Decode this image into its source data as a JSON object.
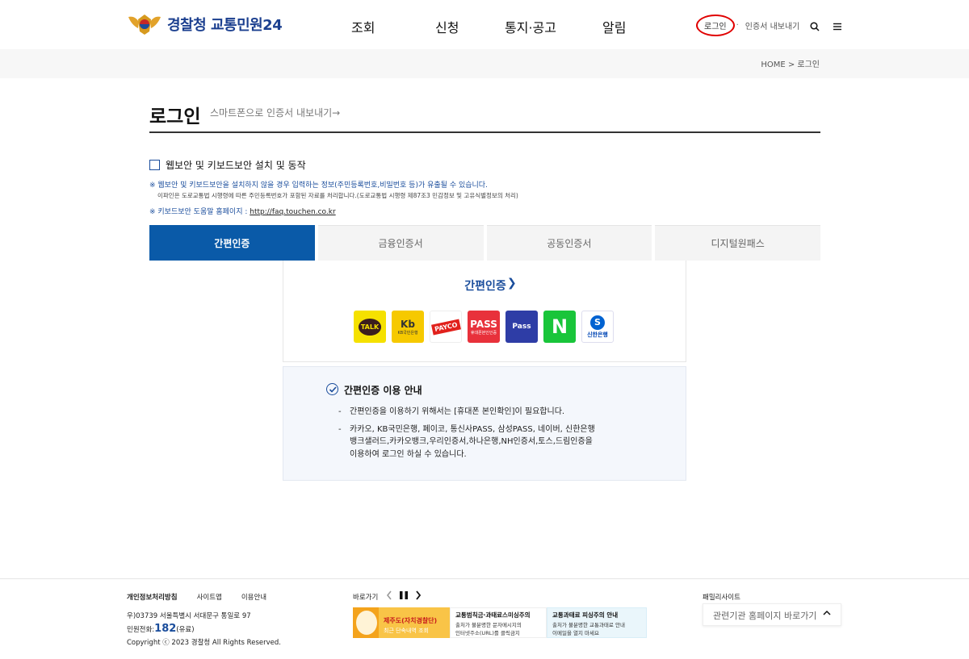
{
  "header": {
    "logo_text": "경찰청 교통민원24",
    "nav": [
      "조회",
      "신청",
      "통지·공고",
      "알림"
    ],
    "util_login": "로그인",
    "util_dot": "·",
    "util_export": "인증서 내보내기"
  },
  "breadcrumb": "HOME > 로그인",
  "page": {
    "title": "로그인",
    "subtitle": "스마트폰으로 인증서 내보내기→"
  },
  "security": {
    "checkbox_label": "웹보안 및 키보드보안 설치 및 동작",
    "notice1": "※ 웹보안 및 키보드보안을 설치하지 않을 경우 입력하는 정보(주민등록번호,비밀번호 등)가 유출될 수 있습니다.",
    "notice1b": "이파인은 도로교통법 시행령에 따른 주민등록번호가 포함된 자료를 처리합니다.(도로교통법 시행령 제87조3 민감정보 및 고유식별정보의 처리)",
    "notice2_prefix": "※ 키보드보안 도움말 홈페이지 : ",
    "notice2_link": "http://faq.touchen.co.kr"
  },
  "tabs": [
    "간편인증",
    "금융인증서",
    "공동인증서",
    "디지털원패스"
  ],
  "simple_auth": {
    "title": "간편인증",
    "chevron": "❯",
    "providers": [
      {
        "name": "kakao",
        "label": "TALK"
      },
      {
        "name": "kb",
        "label": "Kb",
        "sub": "KB국민은행"
      },
      {
        "name": "payco",
        "label": "PAYCO"
      },
      {
        "name": "pass",
        "label": "PASS",
        "sub": "휴대폰본인인증"
      },
      {
        "name": "samsung-pass",
        "label": "Pass"
      },
      {
        "name": "naver",
        "label": "N"
      },
      {
        "name": "shinhan",
        "label": "신한은행",
        "sub": "S"
      }
    ]
  },
  "guide": {
    "title": "간편인증 이용 안내",
    "items": [
      "간편인증을 이용하기 위해서는 [휴대폰 본인확인]이 필요합니다.",
      "카카오, KB국민은행, 페이코, 통신사PASS, 삼성PASS, 네이버, 신한은행",
      "뱅크샐러드,카카오뱅크,우리인증서,하나은행,NH인증서,토스,드림인증을",
      "이용하여 로그인 하실 수 있습니다."
    ]
  },
  "footer": {
    "links": [
      "개인정보처리방침",
      "사이트맵",
      "이용안내"
    ],
    "address": "우)03739 서울특별시 서대문구 통일로 97",
    "tel_prefix": "민원전화:",
    "tel_number": "182",
    "tel_suffix": "(유료)",
    "copyright": "Copyright ⓒ 2023 경찰청 All Rights Reserved.",
    "quick_label": "바로가기",
    "banners": [
      {
        "line1": "제주도(자치경찰단)",
        "line2": "최근 단속내역 조회"
      },
      {
        "title": "교통범칙금·과태료스미싱주의",
        "line1": "출처가 불분명한 문자메시지의",
        "line2": "인터넷주소(URL)를 클릭금지"
      },
      {
        "title": "교통과태료 피싱주의 안내",
        "line1": "출처가 불분명한 교통과태료 안내",
        "line2": "이메일을 열지 마세요"
      }
    ],
    "family_label": "패밀리사이트",
    "family_select": "관련기관 홈페이지 바로가기"
  }
}
